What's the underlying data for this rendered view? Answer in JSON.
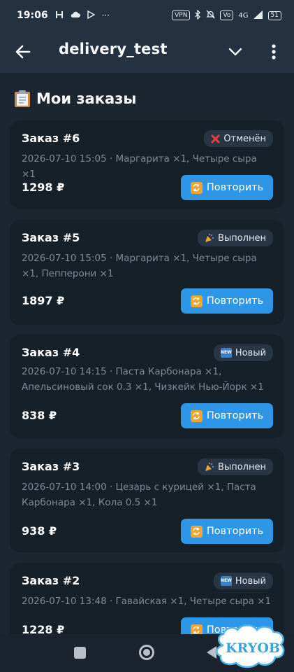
{
  "status_bar": {
    "time": "19:06",
    "more": "···",
    "vpn": "VPN",
    "network": "4G",
    "volte": "Vo",
    "battery": "51"
  },
  "app_bar": {
    "title": "delivery_test"
  },
  "page": {
    "title": "Мои заказы"
  },
  "currency": "₽",
  "repeat_label": "Повторить",
  "orders": [
    {
      "title": "Заказ #6",
      "status": "Отменён",
      "status_icon": "cross-mark-icon",
      "details": "2026-07-10 15:05 · Маргарита ×1, Четыре сыра ×1",
      "total": "1298 ₽"
    },
    {
      "title": "Заказ #5",
      "status": "Выполнен",
      "status_icon": "party-popper-icon",
      "details": "2026-07-10 15:05 · Маргарита ×1, Четыре сыра ×1, Пепперони ×1",
      "total": "1897 ₽"
    },
    {
      "title": "Заказ #4",
      "status": "Новый",
      "status_icon": "new-badge-icon",
      "details": "2026-07-10 14:15 · Паста Карбонара ×1, Апельсиновый сок 0.3 ×1, Чизкейк Нью-Йорк ×1",
      "total": "838 ₽"
    },
    {
      "title": "Заказ #3",
      "status": "Выполнен",
      "status_icon": "party-popper-icon",
      "details": "2026-07-10 14:00 · Цезарь с курицей ×1, Паста Карбонара ×1, Кола 0.5 ×1",
      "total": "938 ₽"
    },
    {
      "title": "Заказ #2",
      "status": "Новый",
      "status_icon": "new-badge-icon",
      "details": "2026-07-10 13:48 · Гавайская ×1, Четыре сыра ×1",
      "total": "1228 ₽"
    }
  ],
  "watermark": {
    "text": "KRYOB"
  },
  "colors": {
    "background": "#1c2631",
    "card": "#162029",
    "accent": "#2d96e6",
    "badge": "#283544",
    "muted_text": "#7d8a97"
  }
}
